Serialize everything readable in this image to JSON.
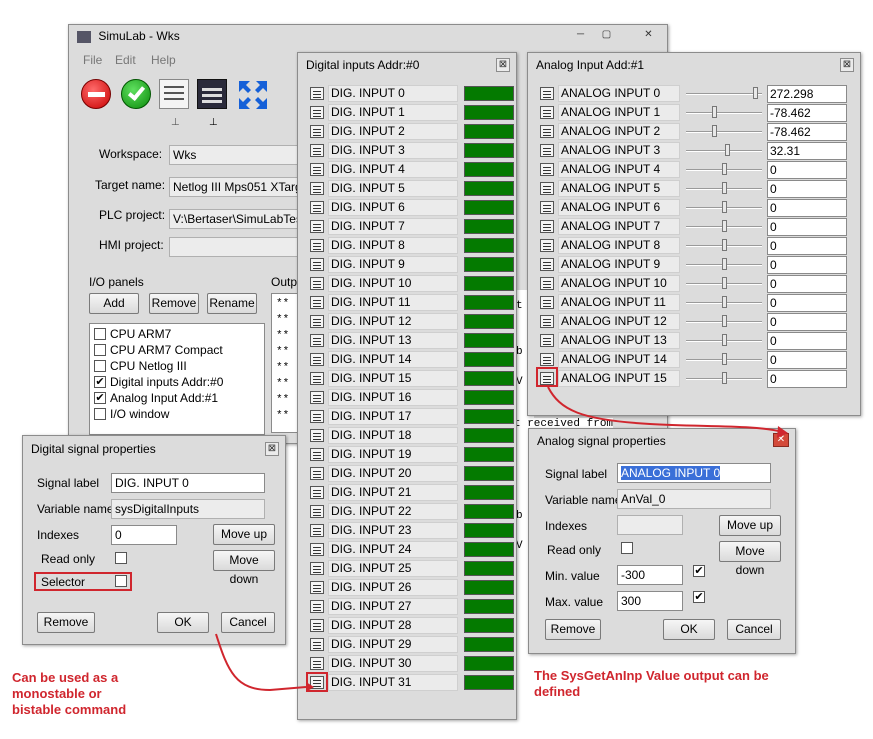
{
  "wks": {
    "title": "SimuLab - Wks",
    "menu": [
      "File",
      "Edit",
      "Help"
    ],
    "workspace_label": "Workspace:",
    "workspace_value": "Wks",
    "target_label": "Target name:",
    "target_value": "Netlog III Mps051 XTarget",
    "plc_label": "PLC project:",
    "plc_value": "V:\\Bertaser\\SimuLabTest\\",
    "hmi_label": "HMI project:",
    "hmi_value": "",
    "io_label": "I/O panels",
    "output_label": "Outpu",
    "add": "Add",
    "remove": "Remove",
    "rename": "Rename",
    "panels": [
      {
        "label": "CPU ARM7",
        "checked": false
      },
      {
        "label": "CPU ARM7 Compact",
        "checked": false
      },
      {
        "label": "CPU Netlog III",
        "checked": false
      },
      {
        "label": "Digital inputs Addr:#0",
        "checked": true
      },
      {
        "label": "Analog Input Add:#1",
        "checked": true
      },
      {
        "label": "I/O window",
        "checked": false
      }
    ],
    "output_lines": [
      "**",
      "**",
      "**",
      "**",
      "**",
      "**",
      "**",
      "**",
      "**"
    ],
    "output_fragments": [
      "t received from",
      "ea",
      "t",
      "b",
      "V",
      "b",
      "V"
    ]
  },
  "dig": {
    "title": "Digital inputs Addr:#0",
    "close": "⊠",
    "inputs": [
      "DIG. INPUT 0",
      "DIG. INPUT 1",
      "DIG. INPUT 2",
      "DIG. INPUT 3",
      "DIG. INPUT 4",
      "DIG. INPUT 5",
      "DIG. INPUT 6",
      "DIG. INPUT 7",
      "DIG. INPUT 8",
      "DIG. INPUT 9",
      "DIG. INPUT 10",
      "DIG. INPUT 11",
      "DIG. INPUT 12",
      "DIG. INPUT 13",
      "DIG. INPUT 14",
      "DIG. INPUT 15",
      "DIG. INPUT 16",
      "DIG. INPUT 17",
      "DIG. INPUT 18",
      "DIG. INPUT 19",
      "DIG. INPUT 20",
      "DIG. INPUT 21",
      "DIG. INPUT 22",
      "DIG. INPUT 23",
      "DIG. INPUT 24",
      "DIG. INPUT 25",
      "DIG. INPUT 26",
      "DIG. INPUT 27",
      "DIG. INPUT 28",
      "DIG. INPUT 29",
      "DIG. INPUT 30",
      "DIG. INPUT 31"
    ],
    "led_color": "#047a00"
  },
  "ana": {
    "title": "Analog Input Add:#1",
    "close": "⊠",
    "inputs": [
      {
        "label": "ANALOG INPUT 0",
        "value": "272.298",
        "level": 0.95
      },
      {
        "label": "ANALOG INPUT 1",
        "value": "-78.462",
        "level": 0.37
      },
      {
        "label": "ANALOG INPUT 2",
        "value": "-78.462",
        "level": 0.37
      },
      {
        "label": "ANALOG INPUT 3",
        "value": "32.31",
        "level": 0.55
      },
      {
        "label": "ANALOG INPUT 4",
        "value": "0",
        "level": 0.5
      },
      {
        "label": "ANALOG INPUT 5",
        "value": "0",
        "level": 0.5
      },
      {
        "label": "ANALOG INPUT 6",
        "value": "0",
        "level": 0.5
      },
      {
        "label": "ANALOG INPUT 7",
        "value": "0",
        "level": 0.5
      },
      {
        "label": "ANALOG INPUT 8",
        "value": "0",
        "level": 0.5
      },
      {
        "label": "ANALOG INPUT 9",
        "value": "0",
        "level": 0.5
      },
      {
        "label": "ANALOG INPUT 10",
        "value": "0",
        "level": 0.5
      },
      {
        "label": "ANALOG INPUT 11",
        "value": "0",
        "level": 0.5
      },
      {
        "label": "ANALOG INPUT 12",
        "value": "0",
        "level": 0.5
      },
      {
        "label": "ANALOG INPUT 13",
        "value": "0",
        "level": 0.5
      },
      {
        "label": "ANALOG INPUT 14",
        "value": "0",
        "level": 0.5
      },
      {
        "label": "ANALOG INPUT 15",
        "value": "0",
        "level": 0.5
      }
    ]
  },
  "dsp": {
    "title": "Digital signal properties",
    "signal_label": "Signal label",
    "signal_value": "DIG. INPUT 0",
    "var_label": "Variable name",
    "var_value": "sysDigitalInputs",
    "idx_label": "Indexes",
    "idx_value": "0",
    "read_only": "Read only",
    "selector": "Selector",
    "move_up": "Move up",
    "move_down": "Move down",
    "remove": "Remove",
    "ok": "OK",
    "cancel": "Cancel"
  },
  "asp": {
    "title": "Analog signal properties",
    "signal_label": "Signal label",
    "signal_value": "ANALOG INPUT 0",
    "var_label": "Variable name",
    "var_value": "AnVal_0",
    "idx_label": "Indexes",
    "idx_value": "",
    "read_only": "Read only",
    "min_label": "Min. value",
    "min_value": "-300",
    "max_label": "Max. value",
    "max_value": "300",
    "move_up": "Move up",
    "move_down": "Move down",
    "remove": "Remove",
    "ok": "OK",
    "cancel": "Cancel"
  },
  "notes": {
    "left": "Can be used as a monostable or bistable command",
    "right": "The SysGetAnInp Value output can be defined"
  },
  "colors": {
    "highlight": "#d0262e",
    "selected": "#3a6fd8"
  }
}
